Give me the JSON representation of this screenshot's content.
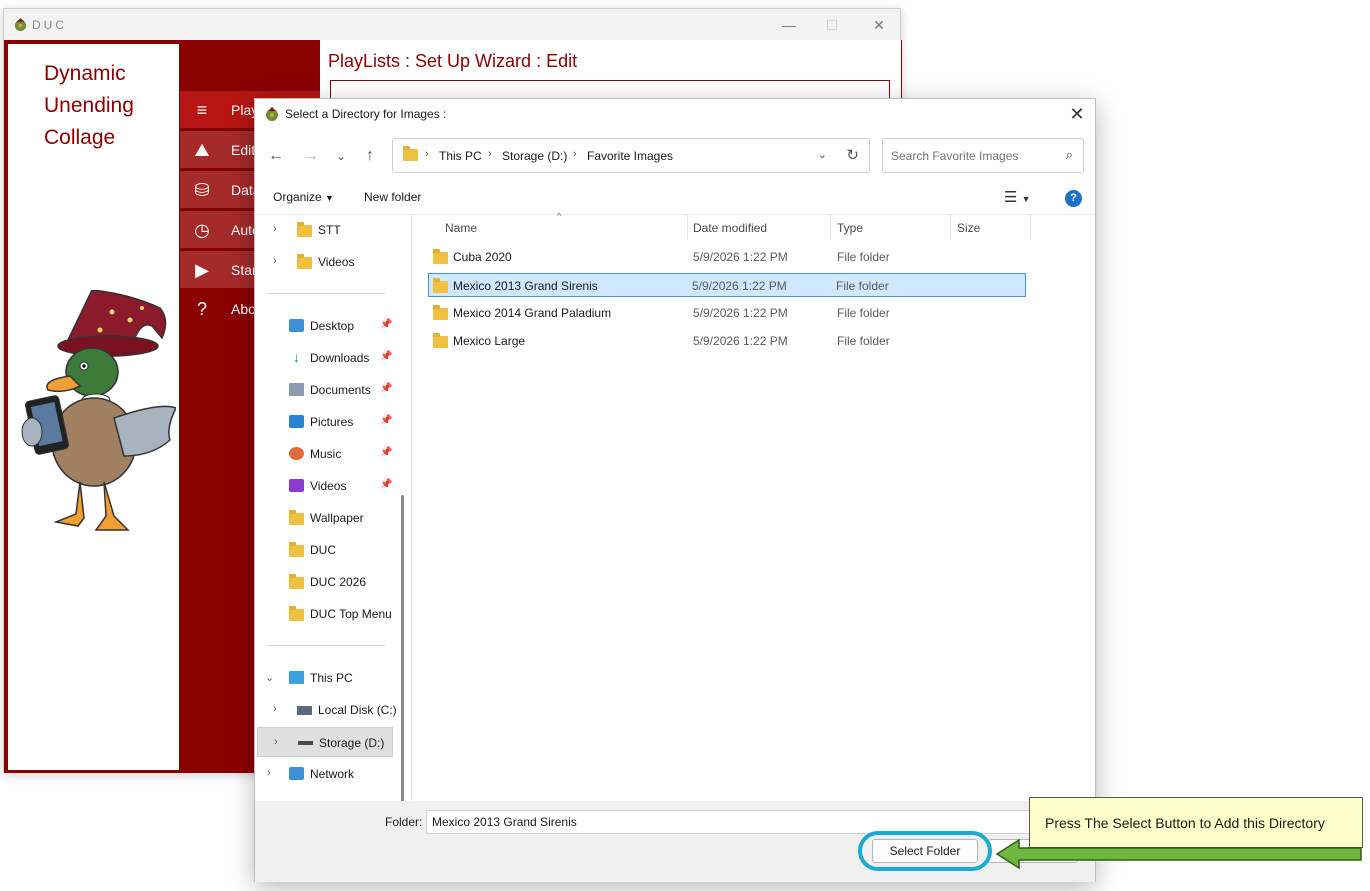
{
  "duc_window": {
    "title": "DUC",
    "brand_lines": [
      "Dynamic",
      "Unending",
      "Collage"
    ],
    "nav": [
      {
        "label": "PlayLists",
        "icon": "playlist-icon"
      },
      {
        "label": "Edit",
        "icon": "image-icon"
      },
      {
        "label": "Database",
        "icon": "database-icon"
      },
      {
        "label": "Automation",
        "icon": "clock-icon"
      },
      {
        "label": "Start",
        "icon": "play-icon"
      },
      {
        "label": "About",
        "icon": "help-circle-icon"
      }
    ],
    "content_title": "PlayLists : Set Up Wizard : Edit",
    "accent_color": "#8b0000"
  },
  "dialog": {
    "title": "Select a Directory for Images :",
    "address": {
      "segments": [
        "This PC",
        "Storage (D:)",
        "Favorite Images"
      ]
    },
    "search": {
      "placeholder": "Search Favorite Images"
    },
    "toolbar": {
      "organize_label": "Organize",
      "new_folder_label": "New folder"
    },
    "nav_pane": {
      "quick": [
        {
          "label": "STT",
          "icon": "folder-icon"
        },
        {
          "label": "Videos",
          "icon": "folder-icon"
        }
      ],
      "pinned": [
        {
          "label": "Desktop",
          "icon": "desktop-icon"
        },
        {
          "label": "Downloads",
          "icon": "download-icon"
        },
        {
          "label": "Documents",
          "icon": "documents-icon"
        },
        {
          "label": "Pictures",
          "icon": "pictures-icon"
        },
        {
          "label": "Music",
          "icon": "music-icon"
        },
        {
          "label": "Videos",
          "icon": "videos-icon"
        }
      ],
      "folders": [
        "Wallpaper",
        "DUC",
        "DUC 2026",
        "DUC Top Menu"
      ],
      "this_pc": "This PC",
      "drives": [
        "Local Disk (C:)",
        "Storage (D:)"
      ],
      "network": "Network"
    },
    "columns": [
      "Name",
      "Date modified",
      "Type",
      "Size"
    ],
    "files": [
      {
        "name": "Cuba 2020",
        "date": "5/9/2026 1:22 PM",
        "type": "File folder",
        "selected": false
      },
      {
        "name": "Mexico 2013 Grand Sirenis",
        "date": "5/9/2026 1:22 PM",
        "type": "File folder",
        "selected": true
      },
      {
        "name": "Mexico 2014 Grand Paladium",
        "date": "5/9/2026 1:22 PM",
        "type": "File folder",
        "selected": false
      },
      {
        "name": "Mexico Large",
        "date": "5/9/2026 1:22 PM",
        "type": "File folder",
        "selected": false
      }
    ],
    "folder_label": "Folder:",
    "folder_value": "Mexico 2013 Grand Sirenis",
    "select_button": "Select Folder"
  },
  "callout": {
    "text": "Press The Select Button to Add this Directory",
    "ring_color": "#1aaad4",
    "arrow_color": "#6fb83f"
  }
}
